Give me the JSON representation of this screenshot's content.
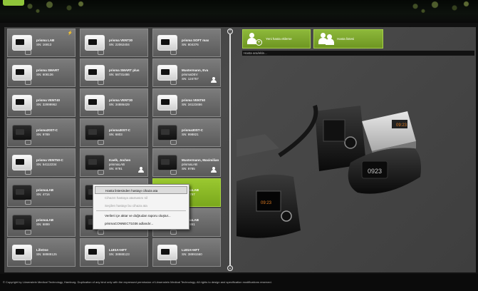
{
  "devices": [
    {
      "name": "prisma LAB",
      "sn": "SN: 16913",
      "style": "light",
      "bolt": true
    },
    {
      "name": "prisma VENT30",
      "sn": "SN: 22062404",
      "style": "light"
    },
    {
      "name": "prisma SOFT max",
      "sn": "SN: 804376",
      "style": "light"
    },
    {
      "name": "prisma SMART",
      "sn": "SN: 608136",
      "style": "light"
    },
    {
      "name": "prisma SMART plus",
      "sn": "SN: 58731486",
      "style": "light"
    },
    {
      "name": "Mustermann, Eva",
      "model": "prismaDEV",
      "sn": "SN: 124757",
      "style": "light",
      "person": true
    },
    {
      "name": "prisma VENT40",
      "sn": "SN: 32999962",
      "style": "light"
    },
    {
      "name": "prisma VENT30",
      "sn": "SN: 34886429",
      "style": "light"
    },
    {
      "name": "prisma VENT50",
      "sn": "SN: 34123456",
      "style": "light"
    },
    {
      "name": "prisma20ST-C",
      "sn": "SN: 9789",
      "style": "dark"
    },
    {
      "name": "prisma30ST-C",
      "sn": "SN: 6803",
      "style": "dark"
    },
    {
      "name": "prisma30ST-C",
      "sn": "SN: 998821",
      "style": "dark"
    },
    {
      "name": "prisma VENT50-C",
      "sn": "SN: 54112234",
      "style": "light"
    },
    {
      "name": "Kaelk, Jochen",
      "model": "prismaLAB",
      "sn": "SN: 9791",
      "style": "dark",
      "person": true
    },
    {
      "name": "Mustermann, Maximilian",
      "model": "prismaLAB",
      "sn": "SN: 9785",
      "style": "dark",
      "person": true
    },
    {
      "name": "prismaLAB",
      "sn": "SN: 4716",
      "style": "dark"
    },
    {
      "name": "",
      "sn": "",
      "style": "dark"
    },
    {
      "name": "prismaLAB",
      "sn": "SN: 4797",
      "style": "dark",
      "selected": true
    },
    {
      "name": "prismaLAB",
      "sn": "SN: 6899",
      "style": "dark"
    },
    {
      "name": "",
      "sn": "",
      "style": "dark"
    },
    {
      "name": "prismaLAB",
      "sn": "SN: 6861",
      "style": "dark"
    },
    {
      "name": "LifeOne",
      "sn": "SN: 58989125",
      "style": "light"
    },
    {
      "name": "LUISA+HFT",
      "sn": "SN: 38988123",
      "style": "light"
    },
    {
      "name": "LUISA+HFT",
      "sn": "SN: 38991560",
      "style": "light"
    }
  ],
  "actions": {
    "new_patient": "Yeni hasta ekleme",
    "patient_list": "Hasta listesi"
  },
  "search": {
    "placeholder": "Hasta ara/ekle..."
  },
  "context_menu": [
    {
      "label": "Hasta listesinden hastayı cihaza ata",
      "state": "selected"
    },
    {
      "label": "Cihazın hastaya atamasını sil",
      "state": "disabled"
    },
    {
      "label": "Seçilen hastayı bu cihaza ata",
      "state": "disabled"
    },
    {
      "label": "Verileri içe aktar ve doğrudan raporu oluştur...",
      "state": "normal"
    },
    {
      "label": "prismaCONNECT1036 adlandır...",
      "state": "normal"
    }
  ],
  "footer": {
    "copyright": "© Copyright by Löwenstein Medical Technology, Hamburg. Duplication of any kind only with the expressed permission of Löwenstein Medical Technology. All rights to design and specification modifications reserved."
  },
  "colors": {
    "accent": "#8db83a",
    "background": "#3e3e3e"
  },
  "icons": [
    "add-patient-icon",
    "patient-list-icon",
    "scroll-up-icon",
    "scroll-down-icon",
    "person-icon",
    "lightning-icon"
  ]
}
